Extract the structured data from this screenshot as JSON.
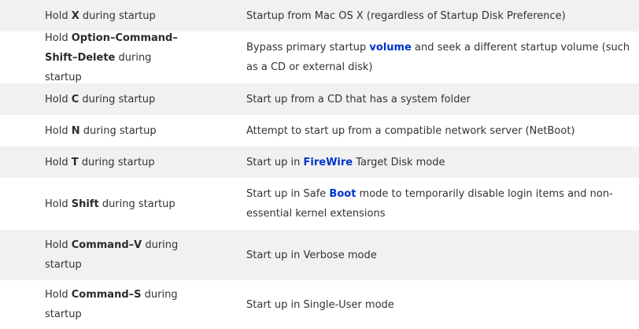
{
  "rows": [
    {
      "key": {
        "pre": "Hold ",
        "bold": "X",
        "post": " during startup"
      },
      "desc": {
        "pre": "Startup from Mac OS X (regardless of Startup Disk Preference)",
        "link": "",
        "post": ""
      }
    },
    {
      "key": {
        "pre": "Hold ",
        "bold": "Option–Command–Shift–Delete",
        "post": " during startup"
      },
      "desc": {
        "pre": "Bypass primary startup ",
        "link": "volume",
        "post": " and seek a different startup volume (such as a CD or external disk)"
      }
    },
    {
      "key": {
        "pre": "Hold ",
        "bold": "C",
        "post": " during startup"
      },
      "desc": {
        "pre": "Start up from a CD that has a system folder",
        "link": "",
        "post": ""
      }
    },
    {
      "key": {
        "pre": "Hold ",
        "bold": "N",
        "post": " during startup"
      },
      "desc": {
        "pre": "Attempt to start up from a compatible network server (NetBoot)",
        "link": "",
        "post": ""
      }
    },
    {
      "key": {
        "pre": "Hold ",
        "bold": "T",
        "post": " during startup"
      },
      "desc": {
        "pre": "Start up in ",
        "link": "FireWire",
        "post": " Target Disk mode"
      }
    },
    {
      "key": {
        "pre": "Hold ",
        "bold": "Shift",
        "post": " during startup"
      },
      "desc": {
        "pre": "Start up in Safe ",
        "link": "Boot",
        "post": " mode to temporarily disable login items and non-essential kernel extensions"
      }
    },
    {
      "key": {
        "pre": "Hold ",
        "bold": "Command–V",
        "post": " during startup"
      },
      "desc": {
        "pre": "Start up in Verbose mode",
        "link": "",
        "post": ""
      }
    },
    {
      "key": {
        "pre": "Hold ",
        "bold": "Command–S",
        "post": " during startup"
      },
      "desc": {
        "pre": "Start up in Single-User mode",
        "link": "",
        "post": ""
      }
    }
  ],
  "colors": {
    "row_alt": "#f1f1f1",
    "row_white": "#ffffff",
    "text": "#333333",
    "link": "#0033cc"
  }
}
